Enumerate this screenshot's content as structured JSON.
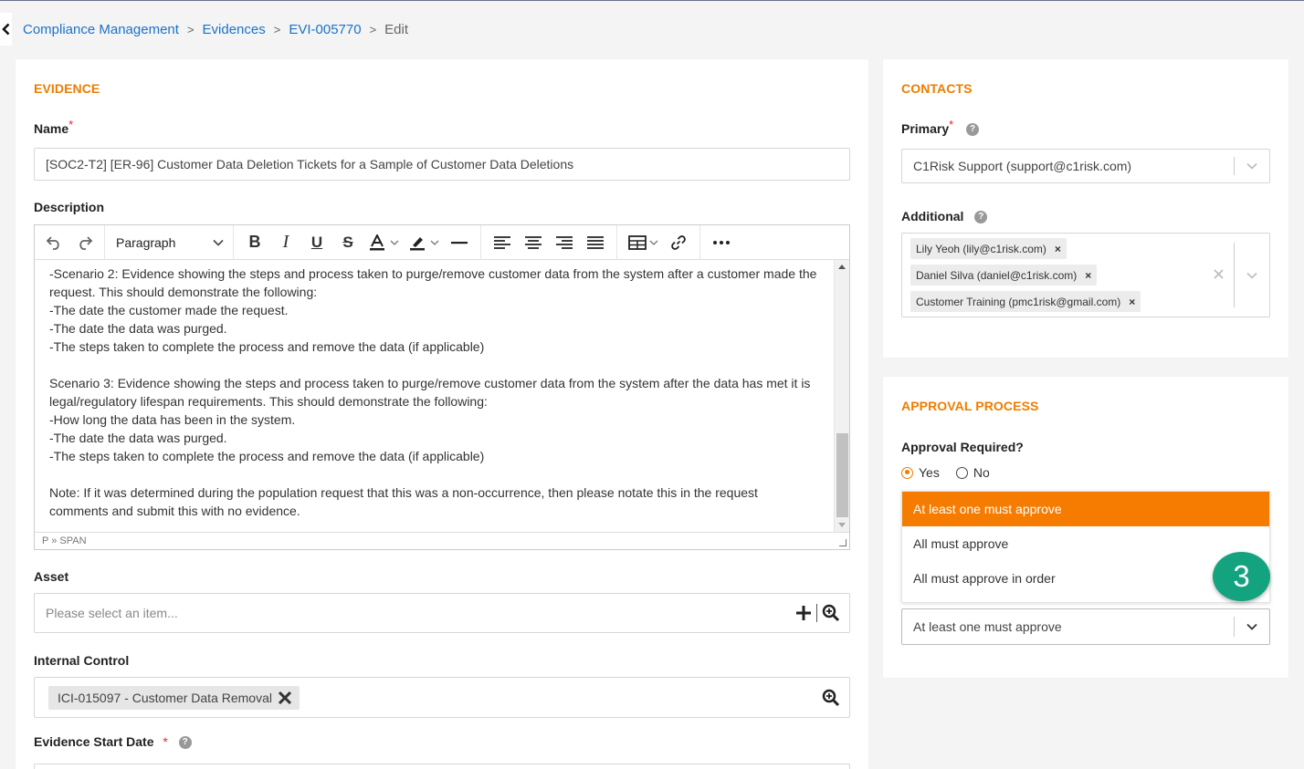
{
  "breadcrumb": {
    "items": [
      "Compliance Management",
      "Evidences",
      "EVI-005770"
    ],
    "current": "Edit",
    "separator": ">"
  },
  "evidence": {
    "section_title": "EVIDENCE",
    "name_label": "Name",
    "name_value": "[SOC2-T2] [ER-96] Customer Data Deletion Tickets for a Sample of Customer Data Deletions",
    "description_label": "Description",
    "editor": {
      "paragraph_select": "Paragraph",
      "lines": [
        "-Scenario 2: Evidence showing the steps and process taken to purge/remove customer data from the system after a customer made the request. This should demonstrate the following:",
        "-The date the customer made the request.",
        "-The date the data was purged.",
        "-The steps taken to complete the process and remove the data (if applicable)",
        "",
        "Scenario 3: Evidence showing the steps and process taken to purge/remove customer data from the system after the data has met it is legal/regulatory lifespan requirements. This should demonstrate the following:",
        "-How long the data has been in the system.",
        "-The date the data was purged.",
        "-The steps taken to complete the process and remove the data (if applicable)",
        "",
        "Note: If it was determined during the population request that this was a non-occurrence, then please notate this in the request comments and submit this with no evidence."
      ],
      "status_path": "P » SPAN"
    },
    "asset_label": "Asset",
    "asset_placeholder": "Please select an item...",
    "internal_control_label": "Internal Control",
    "internal_control_tag": "ICI-015097 - Customer Data Removal",
    "start_date_label": "Evidence Start Date"
  },
  "contacts": {
    "section_title": "CONTACTS",
    "primary_label": "Primary",
    "primary_value": "C1Risk Support (support@c1risk.com)",
    "additional_label": "Additional",
    "additional": [
      "Lily Yeoh (lily@c1risk.com)",
      "Daniel Silva (daniel@c1risk.com)",
      "Customer Training (pmc1risk@gmail.com)"
    ]
  },
  "approval": {
    "section_title": "APPROVAL PROCESS",
    "required_label": "Approval Required?",
    "options": [
      "Yes",
      "No"
    ],
    "selected_option": "Yes",
    "dropdown_options": [
      "At least one must approve",
      "All must approve",
      "All must approve in order"
    ],
    "selected_value": "At least one must approve"
  },
  "step_badge": "3",
  "colors": {
    "accent": "#f07c00",
    "link": "#1a73c9",
    "badge": "#14a37f"
  }
}
